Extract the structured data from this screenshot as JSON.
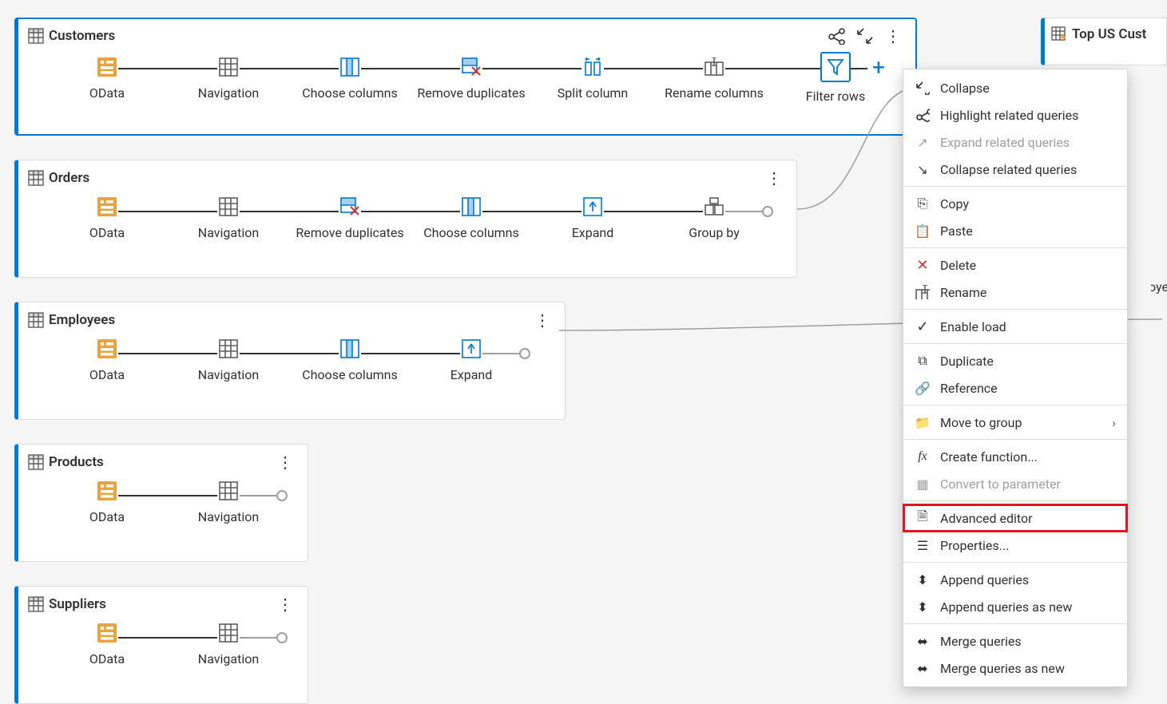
{
  "queries": {
    "customers": {
      "title": "Customers",
      "steps": [
        {
          "label": "OData",
          "icon": "odata"
        },
        {
          "label": "Navigation",
          "icon": "table"
        },
        {
          "label": "Choose columns",
          "icon": "choose-cols"
        },
        {
          "label": "Remove duplicates",
          "icon": "remove-dup"
        },
        {
          "label": "Split column",
          "icon": "split-col"
        },
        {
          "label": "Rename columns",
          "icon": "rename-cols"
        },
        {
          "label": "Filter rows",
          "icon": "filter",
          "selected": true
        }
      ]
    },
    "orders": {
      "title": "Orders",
      "steps": [
        {
          "label": "OData",
          "icon": "odata"
        },
        {
          "label": "Navigation",
          "icon": "table"
        },
        {
          "label": "Remove duplicates",
          "icon": "remove-dup"
        },
        {
          "label": "Choose columns",
          "icon": "choose-cols"
        },
        {
          "label": "Expand",
          "icon": "expand"
        },
        {
          "label": "Group by",
          "icon": "group-by"
        }
      ]
    },
    "employees": {
      "title": "Employees",
      "steps": [
        {
          "label": "OData",
          "icon": "odata"
        },
        {
          "label": "Navigation",
          "icon": "table"
        },
        {
          "label": "Choose columns",
          "icon": "choose-cols"
        },
        {
          "label": "Expand",
          "icon": "expand"
        }
      ]
    },
    "products": {
      "title": "Products",
      "steps": [
        {
          "label": "OData",
          "icon": "odata"
        },
        {
          "label": "Navigation",
          "icon": "table"
        }
      ]
    },
    "suppliers": {
      "title": "Suppliers",
      "steps": [
        {
          "label": "OData",
          "icon": "odata"
        },
        {
          "label": "Navigation",
          "icon": "table"
        }
      ]
    }
  },
  "right_stub": {
    "top_label": "Top US Cust",
    "mid_label": "loye"
  },
  "menu": {
    "collapse": "Collapse",
    "highlight_related": "Highlight related queries",
    "expand_related": "Expand related queries",
    "collapse_related": "Collapse related queries",
    "copy": "Copy",
    "paste": "Paste",
    "delete": "Delete",
    "rename": "Rename",
    "enable_load": "Enable load",
    "duplicate": "Duplicate",
    "reference": "Reference",
    "move_to_group": "Move to group",
    "create_function": "Create function...",
    "convert_to_parameter": "Convert to parameter",
    "advanced_editor": "Advanced editor",
    "properties": "Properties...",
    "append_queries": "Append queries",
    "append_queries_new": "Append queries as new",
    "merge_queries": "Merge queries",
    "merge_queries_new": "Merge queries as new"
  }
}
